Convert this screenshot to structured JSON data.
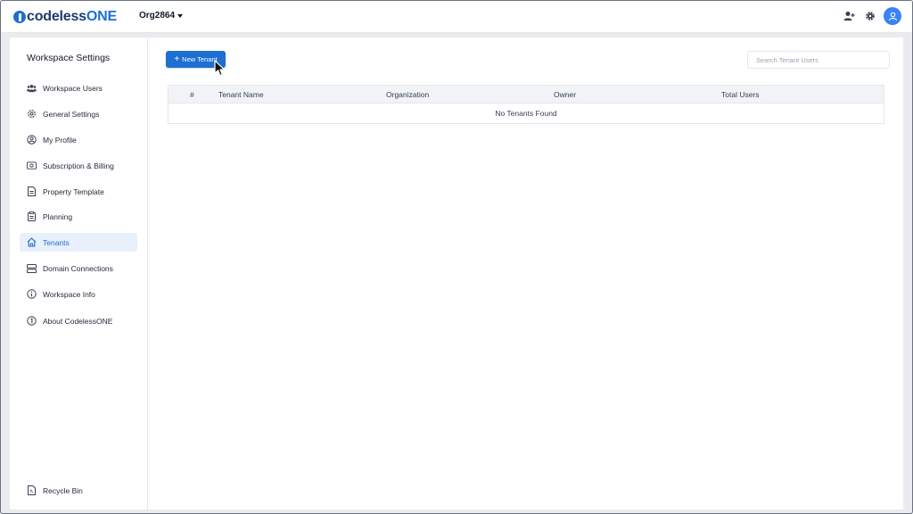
{
  "header": {
    "logo_prefix": "codeless",
    "logo_suffix": "ONE",
    "org_name": "Org2864",
    "icons": [
      "add-user-icon",
      "gear-icon",
      "user-avatar-icon"
    ]
  },
  "sidebar": {
    "title": "Workspace Settings",
    "items": [
      {
        "label": "Workspace Users",
        "icon": "users-icon",
        "active": false
      },
      {
        "label": "General Settings",
        "icon": "gear-icon",
        "active": false
      },
      {
        "label": "My Profile",
        "icon": "profile-icon",
        "active": false
      },
      {
        "label": "Subscription & Billing",
        "icon": "billing-icon",
        "active": false
      },
      {
        "label": "Property Template",
        "icon": "document-icon",
        "active": false
      },
      {
        "label": "Planning",
        "icon": "clipboard-icon",
        "active": false
      },
      {
        "label": "Tenants",
        "icon": "home-icon",
        "active": true
      },
      {
        "label": "Domain Connections",
        "icon": "server-icon",
        "active": false
      },
      {
        "label": "Workspace Info",
        "icon": "info-icon",
        "active": false
      },
      {
        "label": "About CodelessONE",
        "icon": "about-icon",
        "active": false
      }
    ],
    "footer_item": {
      "label": "Recycle Bin",
      "icon": "recycle-bin-icon"
    }
  },
  "main": {
    "new_button_label": "New Tenant",
    "search_placeholder": "Search Tenant Users",
    "table": {
      "columns": [
        "#",
        "Tenant Name",
        "Organization",
        "Owner",
        "Total Users"
      ],
      "empty_message": "No Tenants Found"
    }
  },
  "colors": {
    "accent": "#1d6fd1",
    "active_bg": "#e8f0fb",
    "page_bg": "#e9ebef"
  }
}
